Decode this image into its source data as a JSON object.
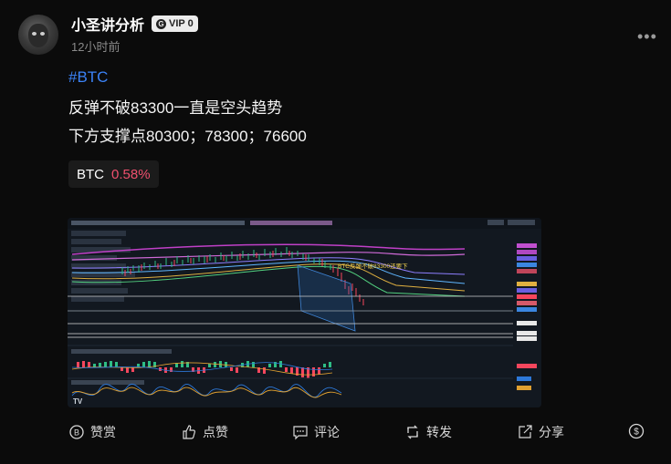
{
  "author": {
    "name": "小圣讲分析",
    "vip_label": "VIP 0",
    "time": "12小时前"
  },
  "post": {
    "hashtag": "#BTC",
    "lines": [
      "反弹不破83300一直是空头趋势",
      "下方支撑点80300；78300；76600"
    ]
  },
  "ticker": {
    "symbol": "BTC",
    "change": "0.58%",
    "change_color": "#f0506e"
  },
  "chart_image": {
    "annotation": "BTC反弹不破83300还要下"
  },
  "actions": {
    "tip": "赞赏",
    "like": "点赞",
    "comment": "评论",
    "repost": "转发",
    "share": "分享"
  },
  "icons": [
    "more-icon",
    "tip-icon",
    "like-icon",
    "comment-icon",
    "repost-icon",
    "share-icon",
    "dollar-icon"
  ]
}
